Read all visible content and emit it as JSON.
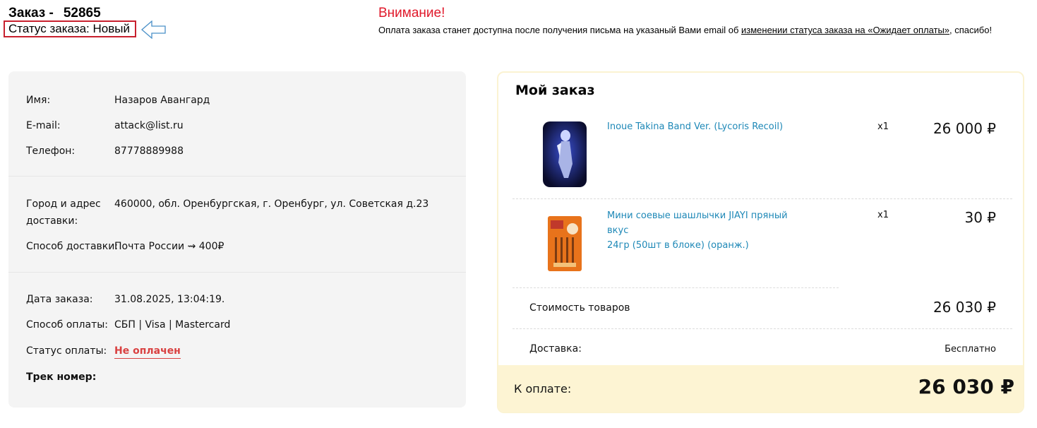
{
  "header": {
    "order_label": "Заказ -",
    "order_number": "52865",
    "status_text": "Статус заказа: Новый"
  },
  "notice": {
    "title": "Внимание!",
    "text_before": "Оплата заказа станет доступна после получения письма на указаный Вами email об ",
    "link_text": "изменении статуса заказа на «Ожидает оплаты»",
    "text_after": ", спасибо!"
  },
  "customer": {
    "name_label": "Имя:",
    "name_value": "Назаров Авангард",
    "email_label": "E-mail:",
    "email_value": "attack@list.ru",
    "phone_label": "Телефон:",
    "phone_value": "87778889988",
    "address_label_1": "Город и адрес",
    "address_label_2": "доставки:",
    "address_value": "460000, обл. Оренбургская, г. Оренбург, ул. Советская д.23",
    "delivery_label": "Способ доставки:",
    "delivery_value": "Почта России ⇝ 400₽",
    "date_label": "Дата заказа:",
    "date_value": "31.08.2025, 13:04:19.",
    "payment_label": "Способ оплаты:",
    "payment_value": "СБП | Visa | Mastercard",
    "pay_status_label": "Статус оплаты:",
    "pay_status_value": "Не оплачен",
    "track_label": "Трек номер:"
  },
  "order": {
    "title": "Мой заказ",
    "items": [
      {
        "name": "Inoue Takina Band Ver. (Lycoris Recoil)",
        "qty": "x1",
        "price": "26 000 ₽"
      },
      {
        "name_line1": "Мини соевые шашлычки JIAYI пряный вкус",
        "name_line2": "24гр (50шт в блоке) (оранж.)",
        "qty": "x1",
        "price": "30 ₽"
      }
    ],
    "subtotal_label": "Стоимость товаров",
    "subtotal_value": "26 030 ₽",
    "shipping_label": "Доставка:",
    "shipping_value": "Бесплатно",
    "total_label": "К оплате:",
    "total_value": "26 030 ₽"
  },
  "colors": {
    "warning_red": "#e0192b",
    "status_border": "#c8202e",
    "link_blue": "#1e88b7",
    "unpaid_red": "#d94141",
    "pay_band": "#fdf4d3"
  }
}
